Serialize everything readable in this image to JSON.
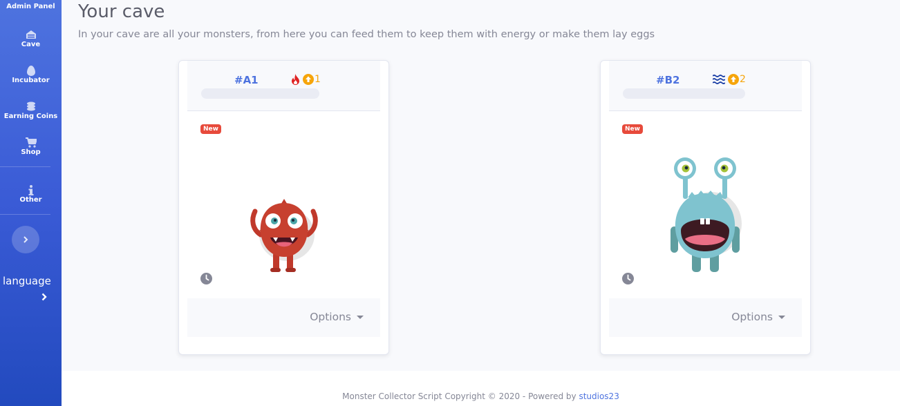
{
  "sidebar": {
    "items": [
      {
        "label": "Admin Panel",
        "icon": "admin-icon"
      },
      {
        "label": "Cave",
        "icon": "cave-icon"
      },
      {
        "label": "Incubator",
        "icon": "egg-icon"
      },
      {
        "label": "Earning Coins",
        "icon": "coins-icon"
      },
      {
        "label": "Shop",
        "icon": "cart-icon"
      },
      {
        "label": "Other",
        "icon": "info-icon"
      }
    ],
    "toggle_icon": "chevron-right-icon",
    "language_label": "language"
  },
  "page": {
    "title": "Your cave",
    "subtitle": "In your cave are all your monsters, from here you can feed them to keep them with energy or make them lay eggs"
  },
  "monsters": [
    {
      "id": "#A1",
      "element_icon": "fire-icon",
      "level": "1",
      "badge": "New",
      "energy_percent": 0,
      "options_label": "Options",
      "color": "#c0392b"
    },
    {
      "id": "#B2",
      "element_icon": "water-icon",
      "level": "2",
      "badge": "New",
      "energy_percent": 0,
      "options_label": "Options",
      "color": "#7fc3cf"
    }
  ],
  "footer": {
    "text": "Monster Collector Script Copyright © 2020 - Powered by",
    "link": "studios23"
  },
  "colors": {
    "primary": "#4e73df",
    "danger": "#e74a3b",
    "warning": "#f6a50b",
    "muted": "#858796"
  }
}
